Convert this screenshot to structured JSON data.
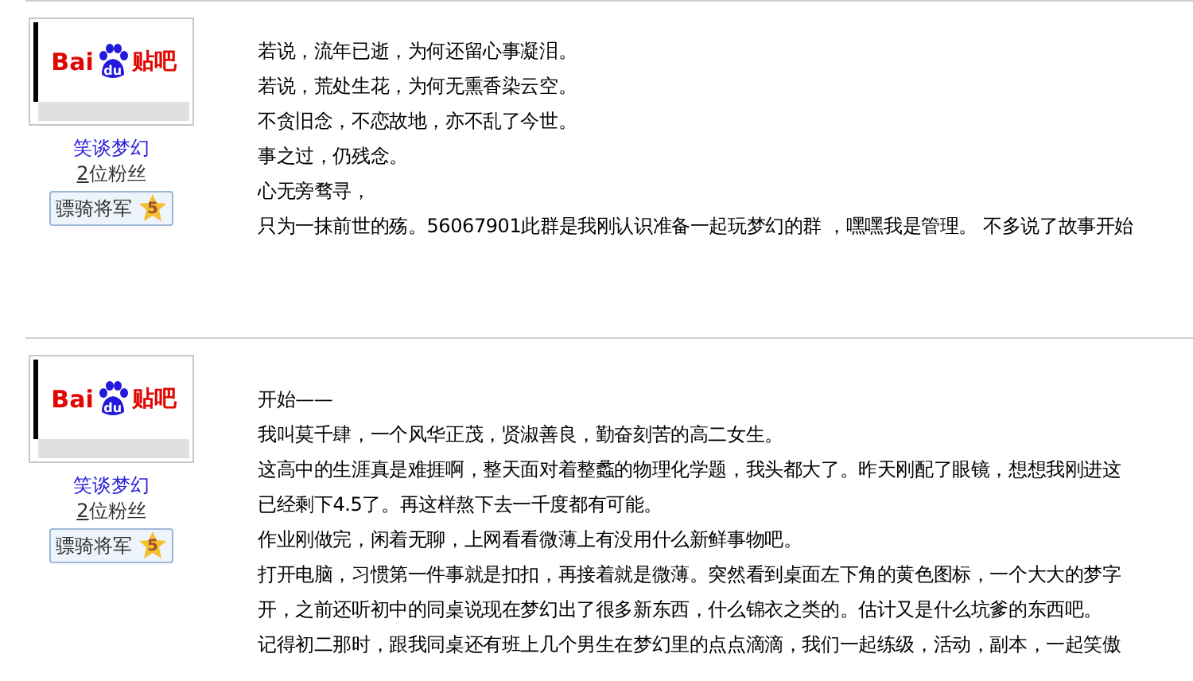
{
  "posts": [
    {
      "author": {
        "logo": {
          "left": "Bai",
          "paw": "du",
          "right": "贴吧"
        },
        "name": "笑谈梦幻",
        "fans_count": "2",
        "fans_label": "位粉丝",
        "rank": "骠骑将军",
        "level": "5"
      },
      "lines": [
        "若说，流年已逝，为何还留心事凝泪。",
        "若说，荒处生花，为何无熏香染云空。",
        "不贪旧念，不恋故地，亦不乱了今世。",
        "事之过，仍残念。",
        "心无旁骛寻，",
        "只为一抹前世的殇。56067901此群是我刚认识准备一起玩梦幻的群 ，嘿嘿我是管理。 不多说了故事开始"
      ]
    },
    {
      "author": {
        "logo": {
          "left": "Bai",
          "paw": "du",
          "right": "贴吧"
        },
        "name": "笑谈梦幻",
        "fans_count": "2",
        "fans_label": "位粉丝",
        "rank": "骠骑将军",
        "level": "5"
      },
      "lines": [
        "开始——",
        "我叫莫千肆，一个风华正茂，贤淑善良，勤奋刻苦的高二女生。",
        "这高中的生涯真是难捱啊，整天面对着整蠡的物理化学题，我头都大了。昨天刚配了眼镜，想想我刚进这",
        "已经剩下4.5了。再这样熬下去一千度都有可能。",
        "作业刚做完，闲着无聊，上网看看微薄上有没用什么新鲜事物吧。",
        "打开电脑，习惯第一件事就是扣扣，再接着就是微薄。突然看到桌面左下角的黄色图标，一个大大的梦字",
        "开，之前还听初中的同桌说现在梦幻出了很多新东西，什么锦衣之类的。估计又是什么坑爹的东西吧。",
        "记得初二那时，跟我同桌还有班上几个男生在梦幻里的点点滴滴，我们一起练级，活动，副本，一起笑傲"
      ]
    }
  ]
}
